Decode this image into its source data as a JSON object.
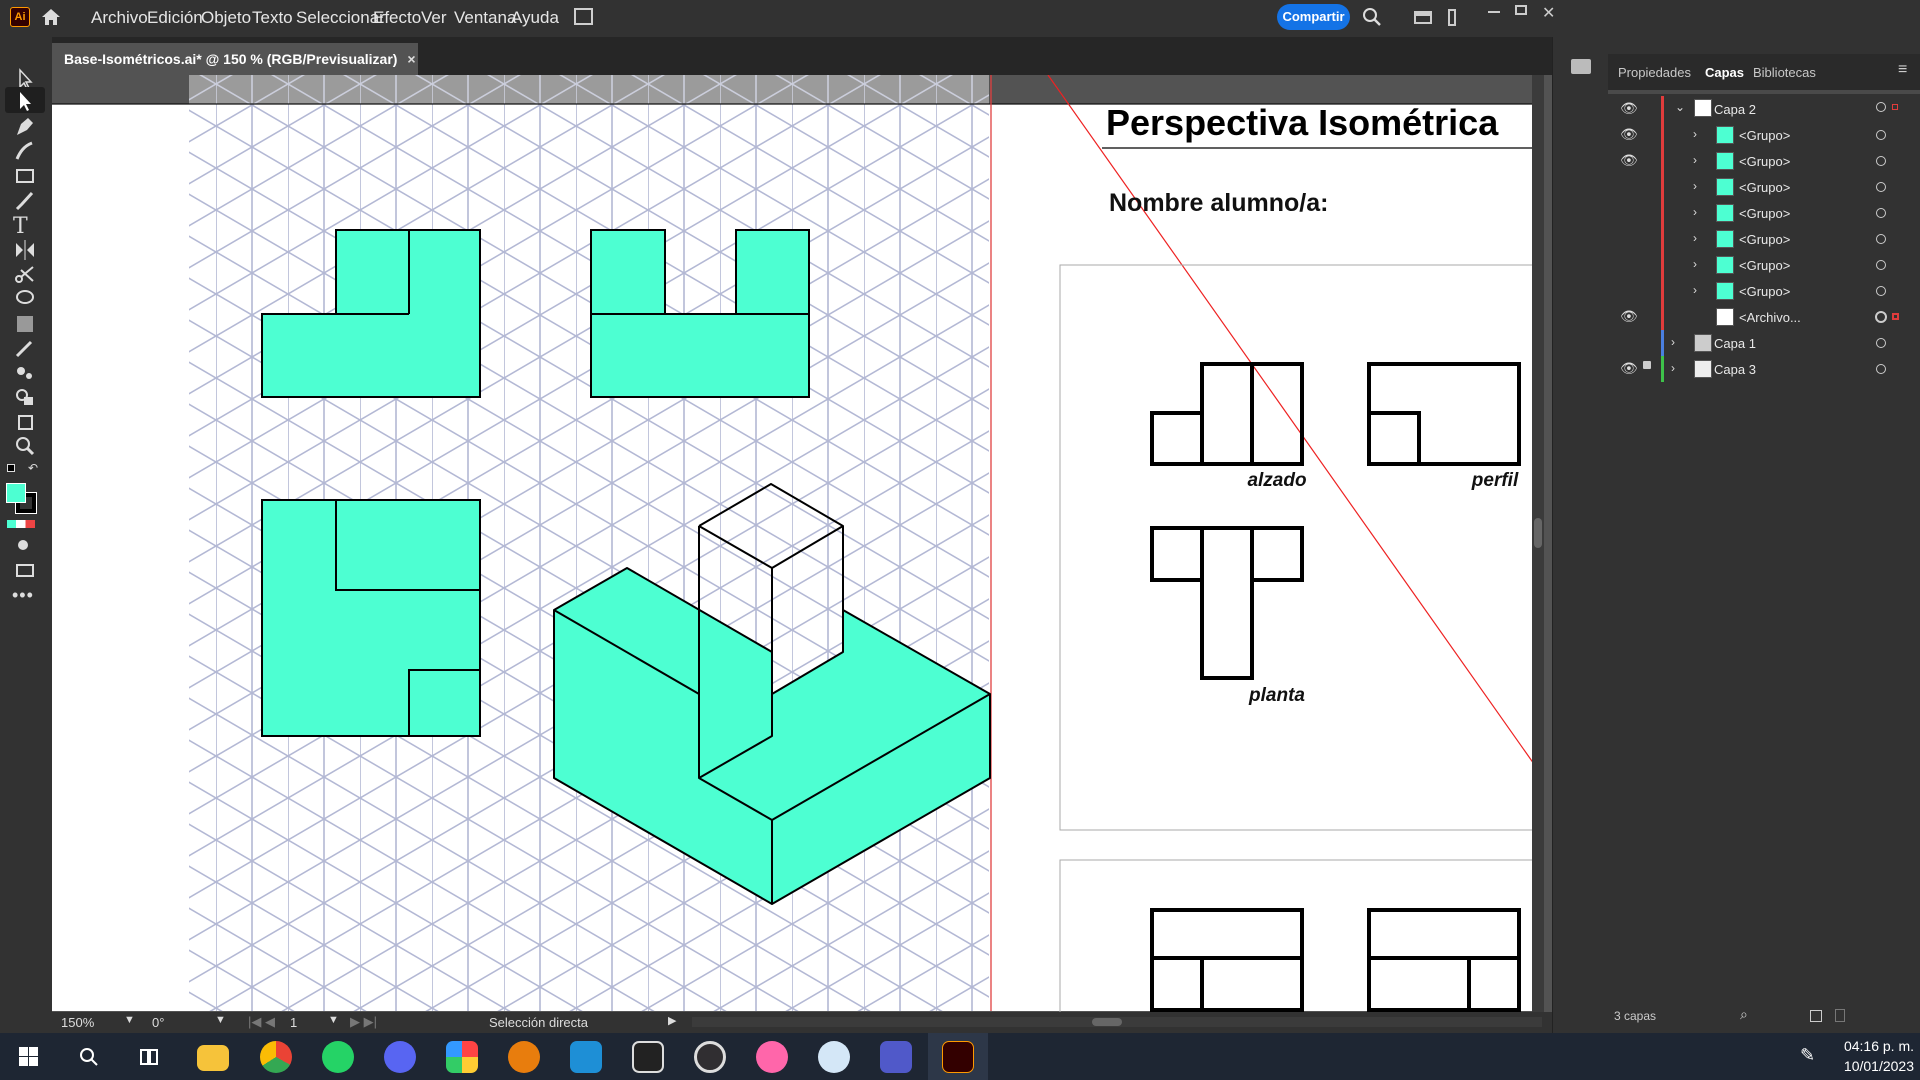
{
  "app": {
    "logo": "Ai",
    "menus": [
      "Archivo",
      "Edición",
      "Objeto",
      "Texto",
      "Seleccionar",
      "Efecto",
      "Ver",
      "Ventana",
      "Ayuda"
    ],
    "share_label": "Compartir"
  },
  "document": {
    "tab_title": "Base-Isométricos.ai* @ 150 % (RGB/Previsualizar)",
    "close_glyph": "×"
  },
  "artboard": {
    "title": "Perspectiva Isométrica",
    "student": "Nombre alumno/a:",
    "view_labels": [
      "alzado",
      "perfil",
      "planta"
    ]
  },
  "status": {
    "zoom": "150%",
    "rotation": "0°",
    "artboard_num": "1",
    "tool_name": "Selección directa"
  },
  "panel": {
    "tabs": [
      "Propiedades",
      "Capas",
      "Bibliotecas"
    ],
    "active_tab": "Capas",
    "layers": [
      {
        "name": "Capa 2",
        "color": "#e03c3c"
      },
      {
        "name": "<Grupo>",
        "color": "#e03c3c"
      },
      {
        "name": "<Grupo>",
        "color": "#e03c3c"
      },
      {
        "name": "<Grupo>",
        "color": "#e03c3c"
      },
      {
        "name": "<Grupo>",
        "color": "#e03c3c"
      },
      {
        "name": "<Grupo>",
        "color": "#e03c3c"
      },
      {
        "name": "<Grupo>",
        "color": "#e03c3c"
      },
      {
        "name": "<Grupo>",
        "color": "#e03c3c"
      },
      {
        "name": "<Archivo...",
        "color": "#e03c3c"
      },
      {
        "name": "Capa 1",
        "color": "#4a7fe0"
      },
      {
        "name": "Capa 3",
        "color": "#3ec24a"
      }
    ],
    "footer_count": "3 capas"
  },
  "colors": {
    "fill": "#4dffd2",
    "accent": "#1473e6"
  },
  "taskbar": {
    "time": "04:16 p. m.",
    "date": "10/01/2023",
    "icons": [
      "windows-start-icon",
      "search-icon",
      "task-view-icon",
      "file-explorer-icon",
      "chrome-icon",
      "whatsapp-icon",
      "discord-icon",
      "app-colorful-icon",
      "blender-icon",
      "mathtype-icon",
      "unity-icon",
      "obs-icon",
      "osu-icon",
      "paint-icon",
      "teams-icon",
      "illustrator-icon"
    ]
  }
}
